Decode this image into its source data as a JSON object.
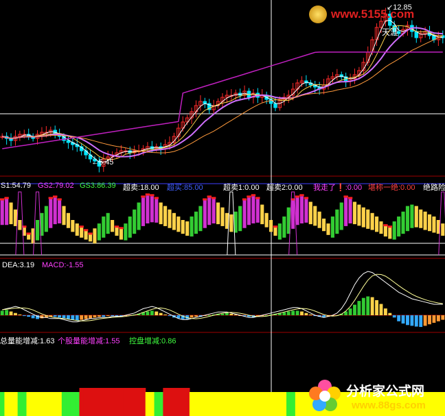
{
  "watermark_top": {
    "text": "www.5155.com",
    "color": "#e02020"
  },
  "watermark_bottom": {
    "title": "分析家公式网",
    "url": "www.88gs.com",
    "title_color": "#ffffff",
    "url_color": "#ffd000"
  },
  "colors": {
    "bg": "#000000",
    "up": "#ff2a2a",
    "down": "#00e5ff",
    "ma_white": "#ffffff",
    "ma_yellow": "#ffd24a",
    "ma_purple": "#d070ff",
    "ma_magenta": "#c020c0",
    "ma_orange": "#ff9a3c",
    "green": "#33cc33",
    "yellow": "#ffd24a",
    "magenta": "#d030d0",
    "red": "#ff2020",
    "orange": "#ff9933",
    "cyan": "#33aaff",
    "grid_red": "#a00000",
    "grid_blue": "#4040ff"
  },
  "panel1": {
    "price_high_label": "12.85",
    "price_low_label": "5.45",
    "note_label": "天涯"
  },
  "panel2": {
    "labels": [
      {
        "text": "S1:54.79",
        "color": "#ffffff"
      },
      {
        "text": "GS2:79.02",
        "color": "#ff40ff"
      },
      {
        "text": "GS3:86.39",
        "color": "#40ff40"
      },
      {
        "text": "超卖:18.00",
        "color": "#ffffff"
      },
      {
        "text": "超买:85.00",
        "color": "#4060ff"
      },
      {
        "text": "超卖1:0.00",
        "color": "#ffffff"
      },
      {
        "text": "超卖2:0.00",
        "color": "#ffffff"
      },
      {
        "text": "我走了❗:0.00",
        "color": "#ff40ff"
      },
      {
        "text": "堪称一绝:0.00",
        "color": "#ff4040"
      },
      {
        "text": "绝路险",
        "color": "#ffffff"
      }
    ]
  },
  "panel3": {
    "labels": [
      {
        "text": "DEA:3.19",
        "color": "#ffffff"
      },
      {
        "text": "MACD:-1.55",
        "color": "#ff40ff"
      }
    ]
  },
  "panel4": {
    "labels": [
      {
        "text": "总量能增减:1.63",
        "color": "#ffffff"
      },
      {
        "text": "个股量能增减:1.55",
        "color": "#ff40ff"
      },
      {
        "text": "控盘增减:0.86",
        "color": "#40ff40"
      }
    ]
  },
  "chart_data": {
    "type": "line",
    "candles": [
      6.9,
      6.8,
      6.7,
      6.9,
      7.0,
      7.0,
      6.9,
      6.8,
      7.0,
      7.1,
      7.1,
      7.2,
      7.0,
      6.9,
      6.7,
      6.6,
      6.5,
      6.4,
      6.2,
      6.0,
      5.8,
      5.7,
      5.45,
      5.8,
      5.9,
      6.0,
      6.1,
      6.2,
      6.2,
      6.1,
      6.2,
      6.2,
      6.3,
      6.4,
      6.3,
      6.4,
      6.3,
      6.5,
      6.6,
      6.9,
      7.3,
      7.6,
      7.8,
      8.1,
      8.4,
      8.6,
      8.5,
      8.2,
      8.4,
      8.6,
      8.8,
      8.9,
      8.9,
      9.0,
      8.9,
      9.1,
      8.8,
      9.0,
      8.8,
      8.9,
      8.7,
      8.5,
      8.3,
      8.7,
      8.8,
      8.9,
      9.2,
      9.5,
      9.6,
      9.5,
      9.4,
      9.3,
      9.2,
      9.4,
      9.7,
      9.8,
      9.9,
      9.8,
      9.6,
      9.7,
      9.9,
      10.1,
      10.5,
      11.0,
      11.6,
      12.2,
      12.5,
      12.85,
      12.3,
      12.0,
      11.9,
      12.1,
      12.3,
      12.0,
      11.7,
      11.9,
      12.0,
      11.8,
      11.6,
      11.8,
      11.7
    ],
    "osc_values": [
      78,
      80,
      75,
      65,
      50,
      40,
      30,
      38,
      50,
      60,
      70,
      80,
      82,
      78,
      70,
      60,
      50,
      45,
      40,
      35,
      30,
      38,
      45,
      55,
      60,
      50,
      40,
      38,
      45,
      55,
      65,
      75,
      82,
      85,
      84,
      80,
      75,
      70,
      65,
      60,
      55,
      50,
      48,
      55,
      62,
      70,
      78,
      82,
      80,
      75,
      68,
      60,
      58,
      62,
      70,
      78,
      82,
      84,
      80,
      72,
      60,
      50,
      40,
      45,
      55,
      68,
      78,
      82,
      84,
      80,
      76,
      70,
      62,
      52,
      45,
      55,
      65,
      75,
      82,
      80,
      76,
      72,
      68,
      65,
      60,
      55,
      48,
      42,
      40,
      48,
      55,
      62,
      70,
      72,
      70,
      65,
      62,
      58,
      55,
      50,
      45
    ],
    "macd_values": [
      0.6,
      0.7,
      0.5,
      0.3,
      0.1,
      -0.1,
      -0.2,
      -0.4,
      -0.5,
      -0.4,
      -0.3,
      -0.2,
      -0.2,
      -0.3,
      -0.4,
      -0.5,
      -0.6,
      -0.7,
      -0.6,
      -0.5,
      -0.4,
      -0.3,
      -0.2,
      -0.2,
      -0.1,
      -0.1,
      -0.2,
      -0.2,
      -0.1,
      0.0,
      0.1,
      0.2,
      0.4,
      0.5,
      0.6,
      0.5,
      0.3,
      0.1,
      -0.1,
      -0.3,
      -0.4,
      -0.5,
      -0.5,
      -0.3,
      -0.2,
      -0.2,
      -0.1,
      0.0,
      0.1,
      0.2,
      0.2,
      0.3,
      0.2,
      0.1,
      0.0,
      -0.1,
      -0.2,
      -0.3,
      -0.2,
      -0.1,
      0.0,
      0.1,
      0.2,
      0.3,
      0.4,
      0.5,
      0.6,
      0.6,
      0.5,
      0.3,
      0.1,
      -0.1,
      -0.2,
      -0.3,
      -0.2,
      -0.1,
      0.0,
      0.2,
      0.5,
      0.9,
      1.4,
      1.9,
      2.3,
      2.5,
      2.4,
      2.0,
      1.5,
      0.9,
      0.3,
      -0.3,
      -0.8,
      -1.1,
      -1.3,
      -1.4,
      -1.5,
      -1.55,
      -1.4,
      -1.2,
      -1.0,
      -0.8,
      -0.6
    ],
    "dif_values": [
      0.5,
      0.6,
      0.7,
      0.8,
      0.7,
      0.5,
      0.3,
      0.1,
      -0.1,
      -0.2,
      -0.2,
      -0.3,
      -0.3,
      -0.3,
      -0.4,
      -0.5,
      -0.6,
      -0.6,
      -0.5,
      -0.4,
      -0.3,
      -0.3,
      -0.2,
      -0.2,
      -0.2,
      -0.1,
      -0.1,
      -0.1,
      0.0,
      0.1,
      0.2,
      0.4,
      0.6,
      0.7,
      0.8,
      0.7,
      0.5,
      0.3,
      0.1,
      -0.1,
      -0.3,
      -0.4,
      -0.4,
      -0.3,
      -0.2,
      -0.1,
      0.0,
      0.1,
      0.2,
      0.3,
      0.3,
      0.3,
      0.2,
      0.1,
      0.0,
      -0.1,
      -0.2,
      -0.2,
      -0.1,
      0.0,
      0.1,
      0.2,
      0.3,
      0.4,
      0.5,
      0.6,
      0.7,
      0.7,
      0.6,
      0.4,
      0.2,
      0.0,
      -0.1,
      -0.2,
      -0.1,
      0.0,
      0.2,
      0.6,
      1.2,
      2.0,
      2.8,
      3.4,
      3.8,
      4.0,
      3.9,
      3.6,
      3.3,
      3.0,
      2.7,
      2.4,
      2.1,
      1.9,
      1.7,
      1.5,
      1.4,
      1.3,
      1.2,
      1.1,
      1.0,
      1.0,
      1.0
    ],
    "bar_states": [
      "g",
      "y",
      "y",
      "y",
      "g",
      "g",
      "y",
      "y",
      "y",
      "y",
      "y",
      "y",
      "y",
      "y",
      "g",
      "g",
      "g",
      "g",
      "r",
      "r",
      "r",
      "r",
      "r",
      "r",
      "r",
      "r",
      "r",
      "r",
      "r",
      "r",
      "r",
      "r",
      "r",
      "y",
      "y",
      "g",
      "g",
      "r",
      "r",
      "r",
      "r",
      "r",
      "r",
      "y",
      "y",
      "y",
      "y",
      "y",
      "y",
      "y",
      "y",
      "y",
      "y",
      "y",
      "y",
      "y",
      "y",
      "y",
      "y",
      "y",
      "y",
      "y",
      "y",
      "y",
      "y",
      "g",
      "g",
      "y",
      "y",
      "y",
      "y",
      "y",
      "y",
      "y",
      "y",
      "y",
      "y",
      "y",
      "y",
      "y",
      "y",
      "y",
      "y",
      "y",
      "y",
      "y",
      "y",
      "y",
      "y",
      "y",
      "y",
      "y",
      "y",
      "y",
      "y",
      "y",
      "y",
      "y",
      "y",
      "y",
      "y"
    ]
  }
}
